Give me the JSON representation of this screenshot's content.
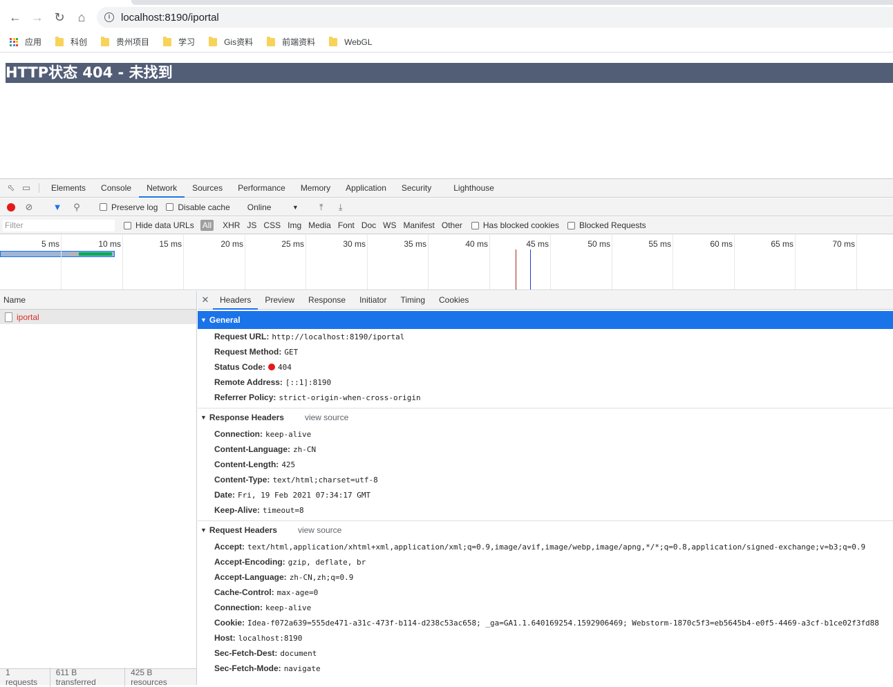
{
  "browser": {
    "url": "localhost:8190/iportal",
    "bookmarks": [
      "应用",
      "科创",
      "贵州项目",
      "学习",
      "Gis资料",
      "前端资料",
      "WebGL"
    ]
  },
  "page": {
    "heading": "HTTP状态 404 - 未找到"
  },
  "devtools": {
    "tabs": [
      "Elements",
      "Console",
      "Network",
      "Sources",
      "Performance",
      "Memory",
      "Application",
      "Security",
      "Lighthouse"
    ],
    "active_tab": "Network",
    "toolbar": {
      "preserve_log": "Preserve log",
      "disable_cache": "Disable cache",
      "throttle": "Online"
    },
    "filter": {
      "placeholder": "Filter",
      "hide_data_urls": "Hide data URLs",
      "types": [
        "All",
        "XHR",
        "JS",
        "CSS",
        "Img",
        "Media",
        "Font",
        "Doc",
        "WS",
        "Manifest",
        "Other"
      ],
      "has_blocked_cookies": "Has blocked cookies",
      "blocked_requests": "Blocked Requests"
    },
    "timeline": {
      "ticks": [
        "5 ms",
        "10 ms",
        "15 ms",
        "20 ms",
        "25 ms",
        "30 ms",
        "35 ms",
        "40 ms",
        "45 ms",
        "50 ms",
        "55 ms",
        "60 ms",
        "65 ms",
        "70 ms"
      ]
    },
    "request_list": {
      "header": "Name",
      "rows": [
        "iportal"
      ],
      "footer": [
        "1 requests",
        "611 B transferred",
        "425 B resources"
      ]
    },
    "details": {
      "tabs": [
        "Headers",
        "Preview",
        "Response",
        "Initiator",
        "Timing",
        "Cookies"
      ],
      "general_title": "General",
      "general": [
        {
          "k": "Request URL:",
          "v": "http://localhost:8190/iportal"
        },
        {
          "k": "Request Method:",
          "v": "GET"
        },
        {
          "k": "Status Code:",
          "v": "404"
        },
        {
          "k": "Remote Address:",
          "v": "[::1]:8190"
        },
        {
          "k": "Referrer Policy:",
          "v": "strict-origin-when-cross-origin"
        }
      ],
      "response_title": "Response Headers",
      "request_title": "Request Headers",
      "view_source": "view source",
      "response_headers": [
        {
          "k": "Connection:",
          "v": "keep-alive"
        },
        {
          "k": "Content-Language:",
          "v": "zh-CN"
        },
        {
          "k": "Content-Length:",
          "v": "425"
        },
        {
          "k": "Content-Type:",
          "v": "text/html;charset=utf-8"
        },
        {
          "k": "Date:",
          "v": "Fri, 19 Feb 2021 07:34:17 GMT"
        },
        {
          "k": "Keep-Alive:",
          "v": "timeout=8"
        }
      ],
      "request_headers": [
        {
          "k": "Accept:",
          "v": "text/html,application/xhtml+xml,application/xml;q=0.9,image/avif,image/webp,image/apng,*/*;q=0.8,application/signed-exchange;v=b3;q=0.9"
        },
        {
          "k": "Accept-Encoding:",
          "v": "gzip, deflate, br"
        },
        {
          "k": "Accept-Language:",
          "v": "zh-CN,zh;q=0.9"
        },
        {
          "k": "Cache-Control:",
          "v": "max-age=0"
        },
        {
          "k": "Connection:",
          "v": "keep-alive"
        },
        {
          "k": "Cookie:",
          "v": "Idea-f072a639=555de471-a31c-473f-b114-d238c53ac658; _ga=GA1.1.640169254.1592906469; Webstorm-1870c5f3=eb5645b4-e0f5-4469-a3cf-b1ce02f3fd88"
        },
        {
          "k": "Host:",
          "v": "localhost:8190"
        },
        {
          "k": "Sec-Fetch-Dest:",
          "v": "document"
        },
        {
          "k": "Sec-Fetch-Mode:",
          "v": "navigate"
        }
      ]
    }
  }
}
